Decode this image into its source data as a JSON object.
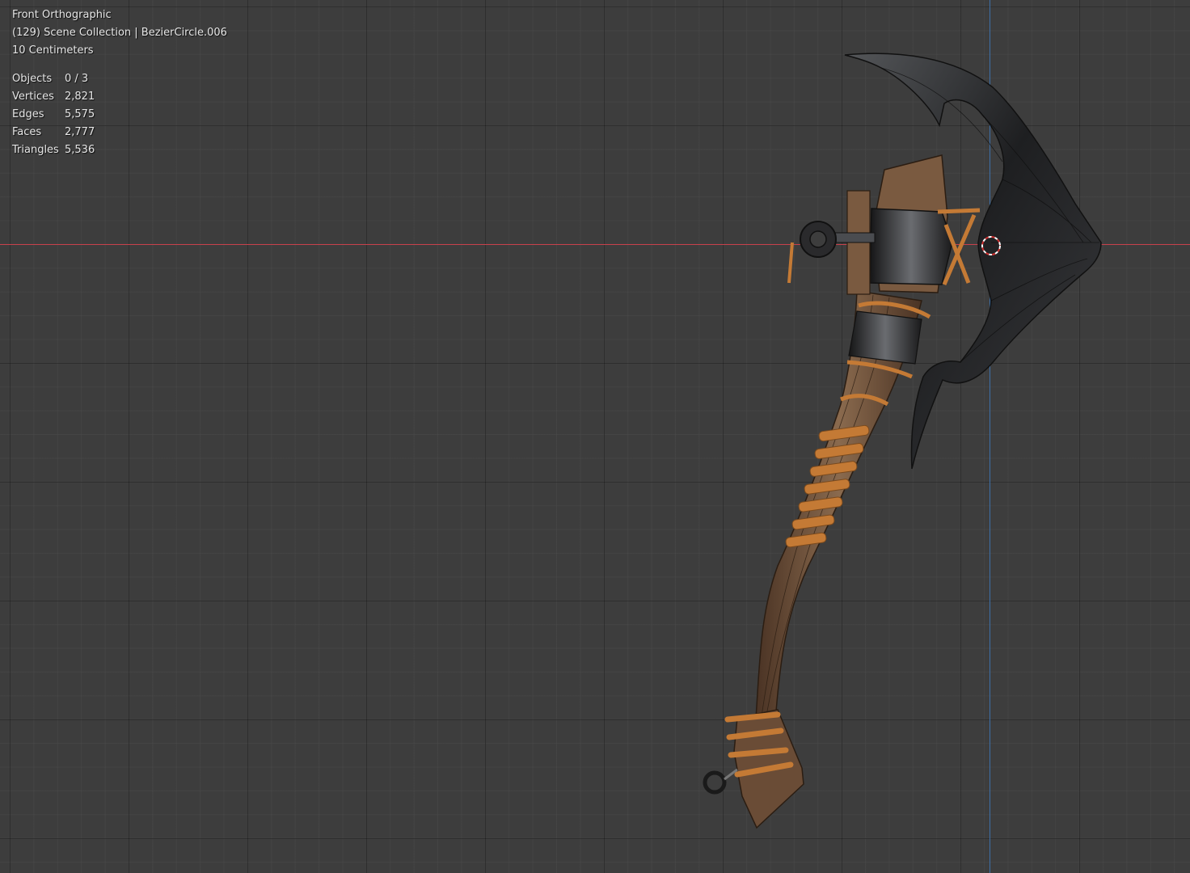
{
  "viewport": {
    "view_name": "Front Orthographic",
    "collection_info": "(129) Scene Collection | BezierCircle.006",
    "grid_scale": "10 Centimeters",
    "colors": {
      "background": "#3d3d3d",
      "x_axis": "#c8414b",
      "z_axis": "#3d6fa8",
      "wood": "#7a5a40",
      "rope": "#c47a35",
      "metal": "#2a2a2c"
    }
  },
  "stats": [
    {
      "label": "Objects",
      "value": "0 / 3"
    },
    {
      "label": "Vertices",
      "value": "2,821"
    },
    {
      "label": "Edges",
      "value": "5,575"
    },
    {
      "label": "Faces",
      "value": "2,777"
    },
    {
      "label": "Triangles",
      "value": "5,536"
    }
  ],
  "icons": {
    "origin": "3d-cursor-icon",
    "model": "axe-mesh"
  }
}
